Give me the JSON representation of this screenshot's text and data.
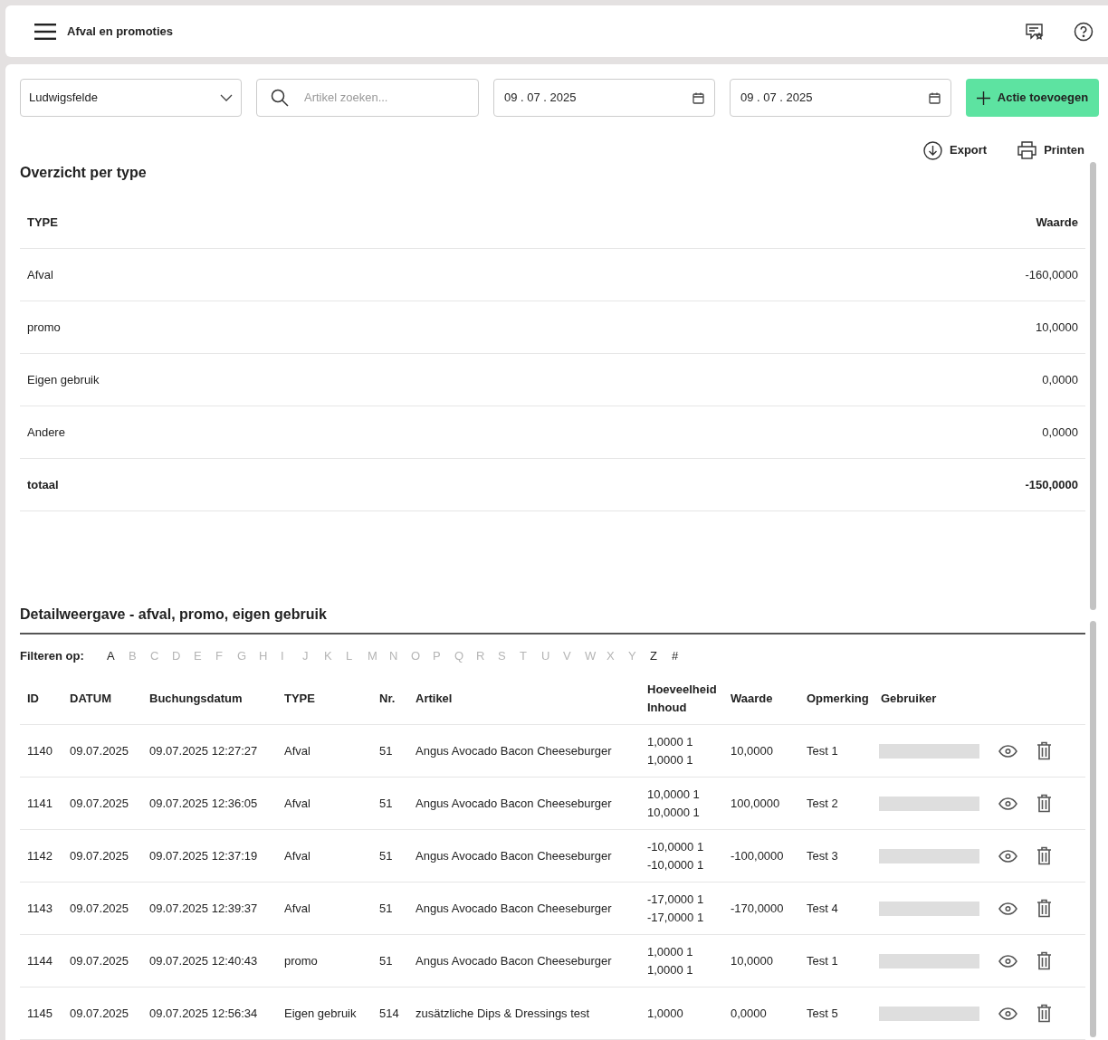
{
  "header": {
    "title": "Afval en promoties"
  },
  "toolbar": {
    "location": "Ludwigsfelde",
    "search": {
      "placeholder": "Artikel zoeken..."
    },
    "date_from": "09 . 07 . 2025",
    "date_to": "09 . 07 . 2025",
    "add_button": "Actie toevoegen"
  },
  "actions": [
    "Export",
    "Printen"
  ],
  "overview": {
    "title": "Overzicht per type",
    "columns": [
      "TYPE",
      "Waarde"
    ],
    "rows": [
      {
        "type": "Afval",
        "value": "-160,0000",
        "total": false
      },
      {
        "type": "promo",
        "value": "10,0000",
        "total": false
      },
      {
        "type": "Eigen gebruik",
        "value": "0,0000",
        "total": false
      },
      {
        "type": "Andere",
        "value": "0,0000",
        "total": false
      },
      {
        "type": "totaal",
        "value": "-150,0000",
        "total": true
      }
    ]
  },
  "detail": {
    "title": "Detailweergave - afval, promo, eigen gebruik",
    "filter_label": "Filteren op:",
    "letters": [
      {
        "label": "A",
        "disabled": false
      },
      {
        "label": "B",
        "disabled": true
      },
      {
        "label": "C",
        "disabled": true
      },
      {
        "label": "D",
        "disabled": true
      },
      {
        "label": "E",
        "disabled": true
      },
      {
        "label": "F",
        "disabled": true
      },
      {
        "label": "G",
        "disabled": true
      },
      {
        "label": "H",
        "disabled": true
      },
      {
        "label": "I",
        "disabled": true
      },
      {
        "label": "J",
        "disabled": true
      },
      {
        "label": "K",
        "disabled": true
      },
      {
        "label": "L",
        "disabled": true
      },
      {
        "label": "M",
        "disabled": true
      },
      {
        "label": "N",
        "disabled": true
      },
      {
        "label": "O",
        "disabled": true
      },
      {
        "label": "P",
        "disabled": true
      },
      {
        "label": "Q",
        "disabled": true
      },
      {
        "label": "R",
        "disabled": true
      },
      {
        "label": "S",
        "disabled": true
      },
      {
        "label": "T",
        "disabled": true
      },
      {
        "label": "U",
        "disabled": true
      },
      {
        "label": "V",
        "disabled": true
      },
      {
        "label": "W",
        "disabled": true
      },
      {
        "label": "X",
        "disabled": true
      },
      {
        "label": "Y",
        "disabled": true
      },
      {
        "label": "Z",
        "disabled": false
      },
      {
        "label": "#",
        "disabled": false
      }
    ],
    "columns": [
      "ID",
      "DATUM",
      "Buchungsdatum",
      "TYPE",
      "Nr.",
      "Artikel",
      "Hoeveelheid",
      "Inhoud",
      "Waarde",
      "Opmerking",
      "Gebruiker"
    ],
    "rows": [
      {
        "id": "1140",
        "datum": "09.07.2025",
        "buchungsdatum": "09.07.2025 12:27:27",
        "type": "Afval",
        "nr": "51",
        "artikel": "Angus Avocado Bacon Cheeseburger",
        "hoeveelheid": "1,0000 1",
        "inhoud": "1,0000 1",
        "waarde": "10,0000",
        "opmerking": "Test 1"
      },
      {
        "id": "1141",
        "datum": "09.07.2025",
        "buchungsdatum": "09.07.2025 12:36:05",
        "type": "Afval",
        "nr": "51",
        "artikel": "Angus Avocado Bacon Cheeseburger",
        "hoeveelheid": "10,0000 1",
        "inhoud": "10,0000 1",
        "waarde": "100,0000",
        "opmerking": "Test 2"
      },
      {
        "id": "1142",
        "datum": "09.07.2025",
        "buchungsdatum": "09.07.2025 12:37:19",
        "type": "Afval",
        "nr": "51",
        "artikel": "Angus Avocado Bacon Cheeseburger",
        "hoeveelheid": "-10,0000 1",
        "inhoud": "-10,0000 1",
        "waarde": "-100,0000",
        "opmerking": "Test 3"
      },
      {
        "id": "1143",
        "datum": "09.07.2025",
        "buchungsdatum": "09.07.2025 12:39:37",
        "type": "Afval",
        "nr": "51",
        "artikel": "Angus Avocado Bacon Cheeseburger",
        "hoeveelheid": "-17,0000 1",
        "inhoud": "-17,0000 1",
        "waarde": "-170,0000",
        "opmerking": "Test 4"
      },
      {
        "id": "1144",
        "datum": "09.07.2025",
        "buchungsdatum": "09.07.2025 12:40:43",
        "type": "promo",
        "nr": "51",
        "artikel": "Angus Avocado Bacon Cheeseburger",
        "hoeveelheid": "1,0000 1",
        "inhoud": "1,0000 1",
        "waarde": "10,0000",
        "opmerking": "Test 1"
      },
      {
        "id": "1145",
        "datum": "09.07.2025",
        "buchungsdatum": "09.07.2025 12:56:34",
        "type": "Eigen gebruik",
        "nr": "514",
        "artikel": "zusätzliche Dips & Dressings test",
        "hoeveelheid": "1,0000",
        "waarde": "0,0000",
        "opmerking": "Test 5"
      }
    ]
  }
}
